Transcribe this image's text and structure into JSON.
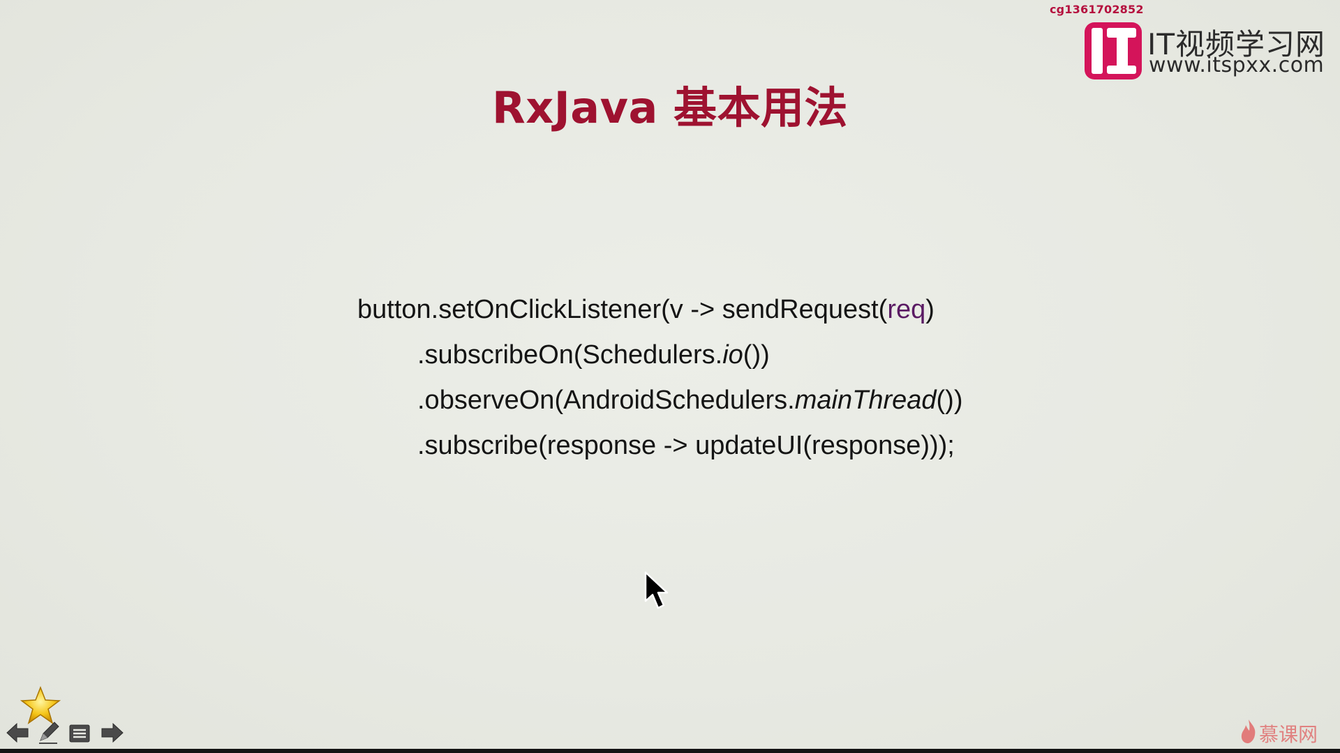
{
  "watermark": {
    "user_id": "cg1361702852"
  },
  "site_logo": {
    "mark_icon": "itspxx-logo-icon",
    "title": "IT视频学习网",
    "url": "www.itspxx.com",
    "brand_color": "#d4145a"
  },
  "slide": {
    "title": "RxJava 基本用法",
    "title_color": "#9e1230",
    "code_lines": [
      {
        "before": "button.setOnClickListener(v -> sendRequest(",
        "var": "req",
        "after": ")"
      },
      {
        "before": ".subscribeOn(Schedulers.",
        "italic": "io",
        "after": "())"
      },
      {
        "before": ".observeOn(AndroidSchedulers.",
        "italic": "mainThread",
        "after": "())"
      },
      {
        "text": ".subscribe(response -> updateUI(response)));"
      }
    ]
  },
  "cursor": {
    "icon": "mouse-pointer-icon"
  },
  "toolbar": {
    "items": [
      {
        "name": "star-icon"
      },
      {
        "name": "previous-arrow-icon"
      },
      {
        "name": "pen-icon"
      },
      {
        "name": "slide-menu-icon"
      },
      {
        "name": "next-arrow-icon"
      }
    ]
  },
  "bottom_brand": {
    "icon": "flame-icon",
    "text": "慕课网",
    "color": "#e07070"
  }
}
